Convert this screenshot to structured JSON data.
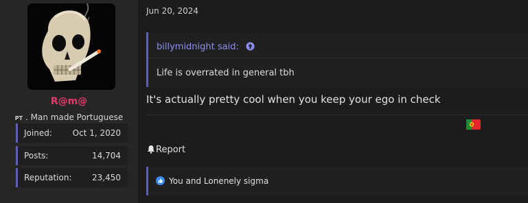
{
  "post": {
    "date": "Jun 20, 2024",
    "message": "It's actually pretty cool when you keep your ego in check",
    "report_label": "Report"
  },
  "user": {
    "name": "R@m@",
    "title_country": "PT",
    "title": "Man made Portuguese",
    "name_color": "#e43a6b",
    "stats": [
      {
        "label": "Joined:",
        "value": "Oct 1, 2020"
      },
      {
        "label": "Posts:",
        "value": "14,704"
      },
      {
        "label": "Reputation:",
        "value": "23,450"
      }
    ]
  },
  "quote": {
    "author": "billymidnight said:",
    "text": "Life is overrated in general tbh"
  },
  "reactions": {
    "text": "You and Lonenely sigma"
  },
  "icons": {
    "jump": "arrow-up-circle-icon",
    "report": "bell-icon",
    "reaction": "thumbs-up-icon",
    "flag": "portugal-flag-icon"
  },
  "colors": {
    "accent": "#5b5ec2",
    "link": "#8c8ff0",
    "background": "#1c1c1d",
    "sidebar": "#262627"
  }
}
